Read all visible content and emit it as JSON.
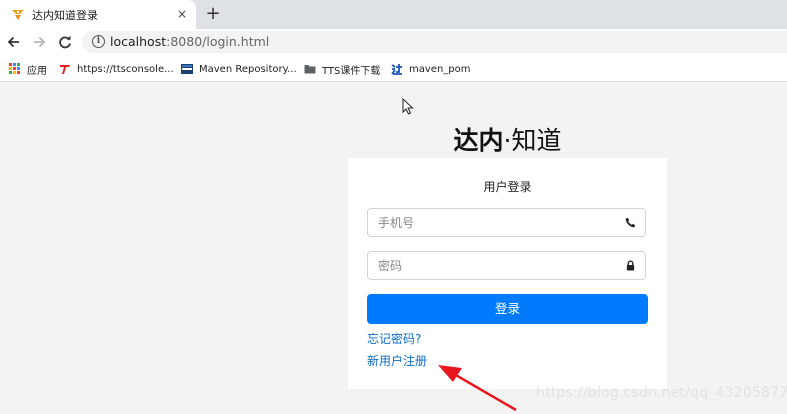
{
  "browser": {
    "tab": {
      "title": "达内知道登录",
      "close_glyph": "×",
      "favicon": "tedu-favicon"
    },
    "newtab_glyph": "+",
    "address": {
      "host": "localhost",
      "rest": ":8080/login.html"
    },
    "bookmarks": [
      {
        "label": "应用",
        "icon": "apps-grid-icon"
      },
      {
        "label": "https://ttsconsole...",
        "icon": "tts-logo-icon"
      },
      {
        "label": "Maven Repository...",
        "icon": "mvn-repository-icon"
      },
      {
        "label": "TTS课件下载",
        "icon": "folder-icon"
      },
      {
        "label": "maven_pom",
        "icon": "tedu-logo-icon"
      }
    ]
  },
  "page": {
    "brand_bold": "达内",
    "brand_dot": "·",
    "brand_rest": "知道",
    "form": {
      "title": "用户登录",
      "phone_placeholder": "手机号",
      "password_placeholder": "密码",
      "submit_label": "登录",
      "forgot_link": "忘记密码?",
      "register_link": "新用户注册"
    },
    "watermark": "https://blog.csdn.net/qq_43205877"
  },
  "colors": {
    "primary": "#007bff",
    "link": "#0a6dc9",
    "annotation_arrow": "#e8171f",
    "background": "#f3f3f3"
  }
}
